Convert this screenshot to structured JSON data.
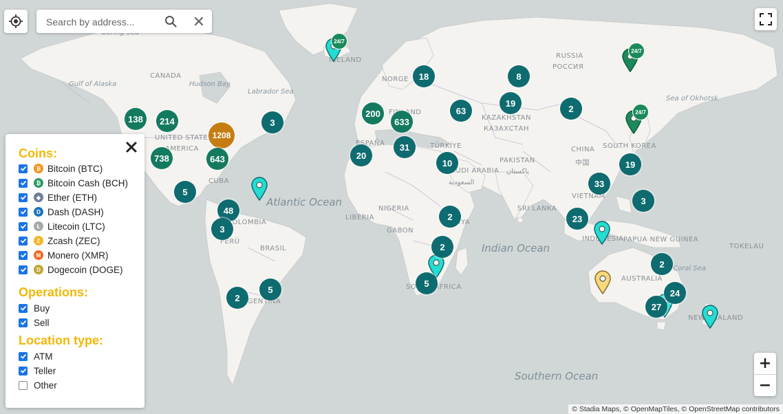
{
  "search": {
    "placeholder": "Search by address..."
  },
  "map": {
    "labels": {
      "bering_sea": "Bering Sea",
      "gulf_of_alaska": "Gulf of Alaska",
      "hudson_bay": "Hudson Bay",
      "labrador_sea": "Labrador Sea",
      "canada": "CANADA",
      "united_states": "UNITED STATES",
      "america": "AMERICA",
      "cuba": "CUBA",
      "colombia": "COLOMBIA",
      "peru": "PERÚ",
      "brasil": "BRASIL",
      "argentina": "ARGENTINA",
      "iceland": "ICELAND",
      "norge": "NORGE",
      "finland": "FINLAND",
      "espana": "ESPAÑA",
      "turkiye": "TÜRKİYE",
      "saudi_arabia": "SAUDI ARABIA",
      "saudi_arabia_ar": "السعودية",
      "kazakhstan": "KAZAKHSTAN",
      "kazakhstan_ru": "КАЗАХСТАН",
      "russia": "RUSSIA",
      "russia_ru": "РОССИЯ",
      "china": "CHINA",
      "china_zh": "中国",
      "south_korea": "SOUTH KOREA",
      "pakistan": "PAKISTAN",
      "pakistan_ur": "پاکستان",
      "sri_lanka": "SRI LANKA",
      "vietnam": "VIETNAM",
      "indonesia": "INDONESIA",
      "papua_new_guinea": "PAPUA NEW GUINEA",
      "australia": "AUSTRALIA",
      "new_zealand": "NEW ZEALAND",
      "tokelau": "TOKELAU",
      "nigeria": "NIGERIA",
      "liberia": "LIBERIA",
      "gabon": "GABON",
      "kenya": "KENYA",
      "south_africa": "SOUTH AFRICA",
      "sea_of_okhotsk": "Sea of Okhotsk",
      "coral_sea": "Coral Sea",
      "atlantic_ocean": "Atlantic Ocean",
      "indian_ocean": "Indian Ocean",
      "southern_ocean": "Southern Ocean"
    },
    "clusters": [
      "138",
      "214",
      "1208",
      "3",
      "738",
      "643",
      "5",
      "48",
      "3",
      "2",
      "5",
      "200",
      "633",
      "18",
      "8",
      "63",
      "19",
      "2",
      "20",
      "31",
      "10",
      "33",
      "19",
      "3",
      "2",
      "2",
      "23",
      "2",
      "27",
      "24",
      "2",
      "5"
    ],
    "badge_247": "24/7",
    "colors": {
      "water": "#d1d6d7",
      "land": "#f4f3f0",
      "cluster": "#0e6b6f",
      "cluster_large": "#c57d12",
      "pin_teal": "#22ddd0",
      "pin_green": "#1a8a5a",
      "pin_yellow": "#f7d87c",
      "accent": "#f2b705"
    }
  },
  "attribution": "© Stadia Maps, © OpenMapTiles, © OpenStreetMap contributors",
  "zoom": {
    "in": "+",
    "out": "−"
  },
  "filters": {
    "coins_title": "Coins:",
    "coins": [
      {
        "label": "Bitcoin (BTC)",
        "checked": true,
        "icon": "bitcoin-icon",
        "color": "#f7931a",
        "glyph": "₿"
      },
      {
        "label": "Bitcoin Cash (BCH)",
        "checked": true,
        "icon": "bitcoin-cash-icon",
        "color": "#2d9b66",
        "glyph": "₿"
      },
      {
        "label": "Ether (ETH)",
        "checked": true,
        "icon": "ether-icon",
        "color": "#6f7d99",
        "glyph": "◆"
      },
      {
        "label": "Dash (DASH)",
        "checked": true,
        "icon": "dash-icon",
        "color": "#1c75bc",
        "glyph": "D"
      },
      {
        "label": "Litecoin (LTC)",
        "checked": true,
        "icon": "litecoin-icon",
        "color": "#a6a9aa",
        "glyph": "Ł"
      },
      {
        "label": "Zcash (ZEC)",
        "checked": true,
        "icon": "zcash-icon",
        "color": "#f4b728",
        "glyph": "Z"
      },
      {
        "label": "Monero (XMR)",
        "checked": true,
        "icon": "monero-icon",
        "color": "#f26822",
        "glyph": "M"
      },
      {
        "label": "Dogecoin (DOGE)",
        "checked": true,
        "icon": "dogecoin-icon",
        "color": "#c2a633",
        "glyph": "D"
      }
    ],
    "operations_title": "Operations:",
    "operations": [
      {
        "label": "Buy",
        "checked": true
      },
      {
        "label": "Sell",
        "checked": true
      }
    ],
    "location_title": "Location type:",
    "locations": [
      {
        "label": "ATM",
        "checked": true
      },
      {
        "label": "Teller",
        "checked": true
      },
      {
        "label": "Other",
        "checked": false
      }
    ]
  }
}
